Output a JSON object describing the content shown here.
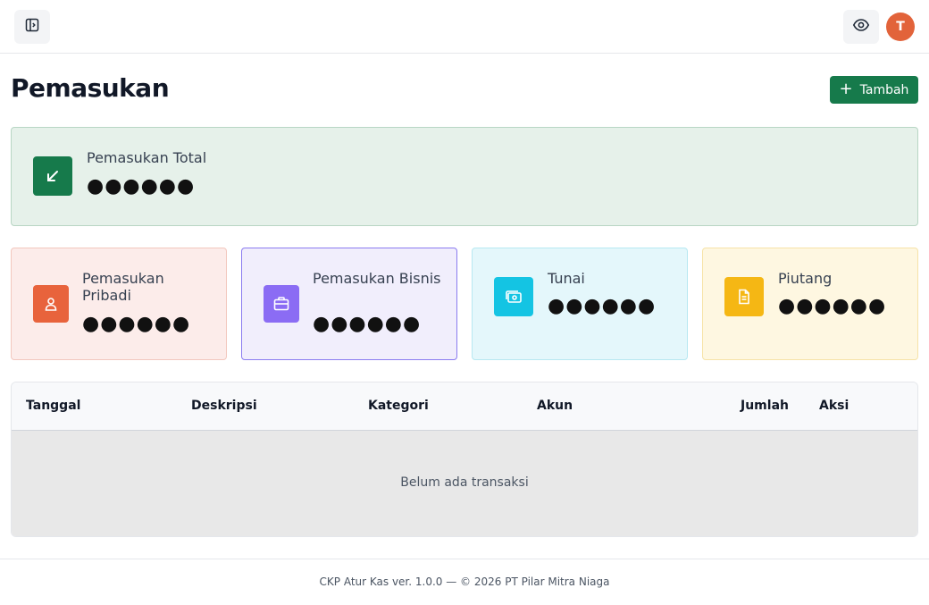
{
  "header": {
    "sidebar_toggle_icon": "sidebar-toggle-icon",
    "visibility_icon": "eye-icon",
    "avatar_initial": "T",
    "avatar_color": "#e2633a"
  },
  "page": {
    "title": "Pemasukan",
    "add_button_label": "Tambah",
    "add_button_icon": "plus-icon"
  },
  "total": {
    "label": "Pemasukan Total",
    "value": "●●●●●●",
    "icon": "arrow-down-left-icon",
    "color": "#167a4b"
  },
  "cards": {
    "pribadi": {
      "label": "Pemasukan Pribadi",
      "value": "●●●●●●",
      "icon": "user-icon",
      "color": "#e8633c"
    },
    "bisnis": {
      "label": "Pemasukan Bisnis",
      "value": "●●●●●●",
      "icon": "briefcase-icon",
      "color": "#8b6cf4"
    },
    "tunai": {
      "label": "Tunai",
      "value": "●●●●●●",
      "icon": "cash-icon",
      "color": "#14c4e3"
    },
    "piutang": {
      "label": "Piutang",
      "value": "●●●●●●",
      "icon": "document-icon",
      "color": "#f5b714"
    }
  },
  "table": {
    "columns": [
      "Tanggal",
      "Deskripsi",
      "Kategori",
      "Akun",
      "Jumlah",
      "Aksi"
    ],
    "empty_message": "Belum ada transaksi"
  },
  "footer": {
    "text": "CKP Atur Kas ver. 1.0.0 — © 2026 PT Pilar Mitra Niaga"
  }
}
